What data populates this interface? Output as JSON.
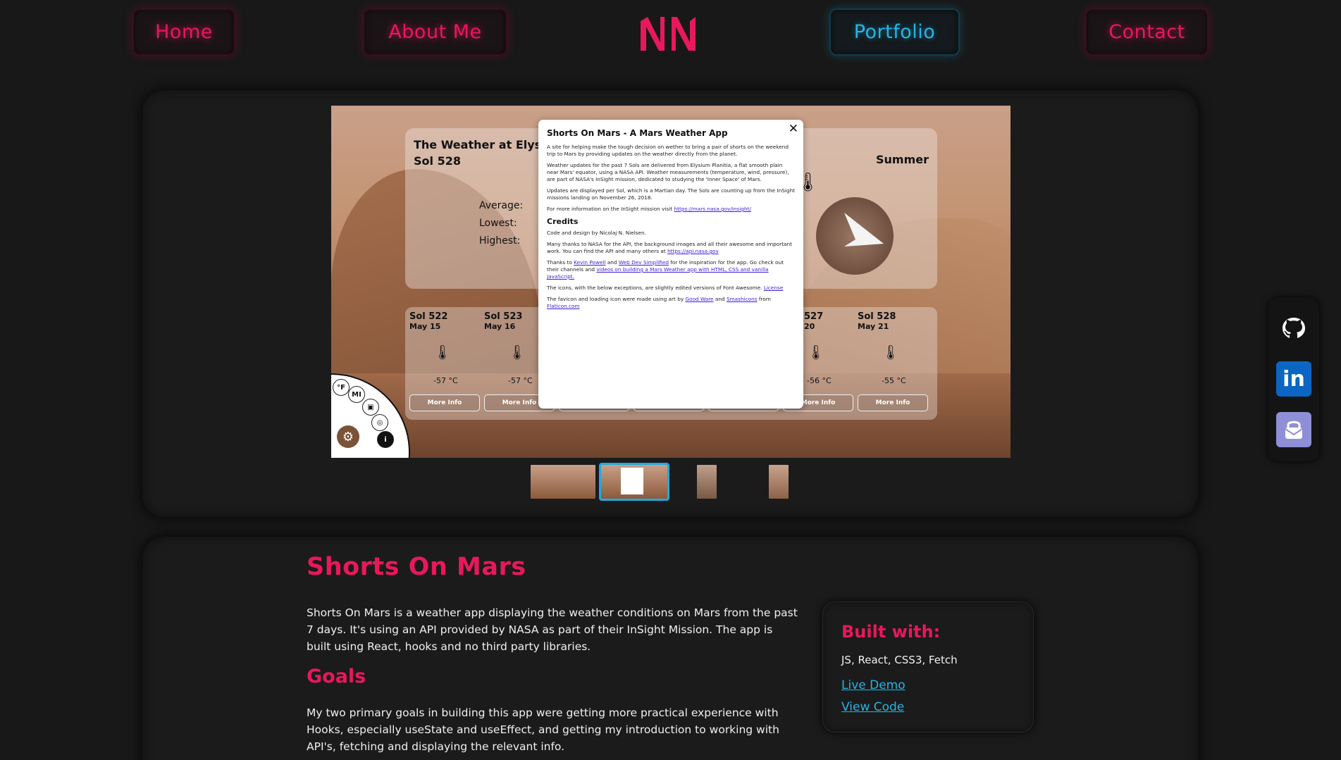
{
  "nav": {
    "home": "Home",
    "about": "About Me",
    "portfolio": "Portfolio",
    "contact": "Contact",
    "logo_text": "NN"
  },
  "screenshot": {
    "weather_title": "The Weather at Elysium",
    "sol": "Sol 528",
    "season": "Summer",
    "stats": {
      "average": "Average:",
      "lowest": "Lowest:",
      "highest": "Highest:"
    },
    "days": [
      {
        "sol": "Sol 522",
        "date": "May 15",
        "temp": "-57 °C",
        "more": "More Info"
      },
      {
        "sol": "Sol 523",
        "date": "May 16",
        "temp": "-57 °C",
        "more": "More Info"
      },
      {
        "sol": "",
        "date": "",
        "temp": "",
        "more": ""
      },
      {
        "sol": "",
        "date": "",
        "temp": "",
        "more": ""
      },
      {
        "sol": "",
        "date": "",
        "temp": "",
        "more": ""
      },
      {
        "sol": "527",
        "date": "20",
        "temp": "-56 °C",
        "more": "More Info"
      },
      {
        "sol": "Sol 528",
        "date": "May 21",
        "temp": "-55 °C",
        "more": "More Info"
      }
    ],
    "menu": {
      "f": "°F",
      "mi": "MI"
    },
    "modal": {
      "title": "Shorts On Mars - A Mars Weather App",
      "p1": "A site for helping make the tough decision on wether to bring a pair of shorts on the weekend trip to Mars by providing updates on the weather directly from the planet.",
      "p2": "Weather updates for the past 7 Sols are delivered from Elysium Planitia, a flat smooth plain near Mars' equator, using a NASA API. Weather measurements (temperature, wind, pressure), are part of NASA's InSight mission, dedicated to studying the 'Inner Space' of Mars.",
      "p3": "Updates are displayed per Sol, which is a Martian day. The Sols are counting up from the InSight missions landing on November 26, 2018.",
      "p4_text": "For more information on the InSight mission visit ",
      "p4_link": "https://mars.nasa.gov/insight/",
      "credits": "Credits",
      "c1": "Code and design by Nicolaj N. Nielsen.",
      "c2_text": "Many thanks to NASA for the API, the background images and all their awesome and important work. You can find the API and many others at ",
      "c2_link": "https://api.nasa.gov",
      "c3_a": "Thanks to ",
      "c3_l1": "Kevin Powell",
      "c3_b": " and ",
      "c3_l2": "Web Dev Simplified",
      "c3_c": " for the inspiration for the app. Go check out their channels and ",
      "c3_l3": "videos on building a Mars Weather app with HTML, CSS and vanilla JavaScript.",
      "c4_text": "The icons, with the below exceptions, are slightly edited versions of Font Awesome. ",
      "c4_link": "License",
      "c5_a": "The favicon and loading icon were made using art by ",
      "c5_l1": "Good Ware",
      "c5_b": " and ",
      "c5_l2": "Smashicons",
      "c5_c": " from ",
      "c5_l3": "Flaticon.com",
      "close": "✕"
    }
  },
  "project": {
    "title": "Shorts On Mars",
    "description": "Shorts On Mars is a weather app displaying the weather conditions on Mars from the past 7 days. It's using an API provided by NASA as part of their InSight Mission. The app is built using React, hooks and no third party libraries.",
    "goals_title": "Goals",
    "goals_text": "My two primary goals in building this app were getting more practical experience with Hooks, especially useState and useEffect, and getting my introduction to working with API's, fetching and displaying the relevant info."
  },
  "built": {
    "title": "Built with:",
    "tech": "JS, React, CSS3, Fetch",
    "live_demo": "Live Demo",
    "view_code": "View Code"
  },
  "side_icons": [
    "github-icon",
    "linkedin-icon",
    "protonmail-icon"
  ],
  "colors": {
    "accent": "#e8185c",
    "active": "#24b5e6",
    "background": "#181818"
  }
}
